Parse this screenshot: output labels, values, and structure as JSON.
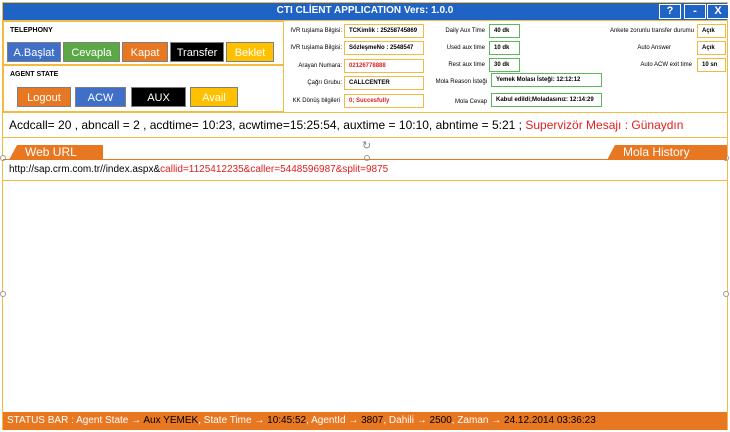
{
  "app": {
    "title": "CTI CLİENT APPLICATION Vers: 1.0.0",
    "help_label": "?",
    "minimize_label": "-",
    "close_label": "X"
  },
  "telephony": {
    "section_label": "TELEPHONY",
    "buttons": [
      {
        "label": "A.Başlat",
        "bg": "#3f6fc6",
        "fg": "#ffffff"
      },
      {
        "label": "Cevapla",
        "bg": "#5aa946",
        "fg": "#ffffff"
      },
      {
        "label": "Kapat",
        "bg": "#e87722",
        "fg": "#ffffff"
      },
      {
        "label": "Transfer",
        "bg": "#000000",
        "fg": "#ffffff"
      },
      {
        "label": "Beklet",
        "bg": "#ffc000",
        "fg": "#ffffff"
      }
    ]
  },
  "agent_state": {
    "section_label": "AGENT STATE",
    "buttons": [
      {
        "label": "Logout",
        "bg": "#e87722",
        "fg": "#ffffff"
      },
      {
        "label": "ACW",
        "bg": "#3f6fc6",
        "fg": "#ffffff"
      },
      {
        "label": "AUX",
        "bg": "#000000",
        "fg": "#ffffff"
      },
      {
        "label": "Avail",
        "bg": "#ffc000",
        "fg": "#ffffff"
      }
    ]
  },
  "call_info": {
    "ivr1_label": "IVR tuşlama Bilgisi:",
    "ivr1_value": "TCKimlik : 25258745869",
    "ivr2_label": "IVR tuşlama Bilgisi:",
    "ivr2_value": "SözleşmeNo : 2548547",
    "caller_label": "Arayan Numara:",
    "caller_value": "02126778888",
    "group_label": "Çağrı Grubu:",
    "group_value": "CALLCENTER",
    "kk_label": "KK Dönüş bilgileri",
    "kk_value": "0; Succesfully"
  },
  "aux_info": {
    "daily_label": "Daily Aux Time",
    "daily_value": "40 dk",
    "used_label": "Used aux time",
    "used_value": "10 dk",
    "rest_label": "Rest aux time",
    "rest_value": "30 dk",
    "reason_label": "Mola Reason İsteği",
    "reason_value": "Yemek Molası İsteği: 12:12:12",
    "reply_label": "Mola Cevap",
    "reply_value": "Kabul edildi;Moladasınız: 12:14:29"
  },
  "settings": {
    "survey_label": "Ankete zorunlu transfer durumu",
    "survey_value": "Açık",
    "answer_label": "Auto Answer",
    "answer_value": "Açık",
    "acw_label": "Auto ACW exit time",
    "acw_value": "10 sn"
  },
  "stats": {
    "text": "Acdcall= 20 , abncall = 2 , acdtime= 10:23, acwtime=15:25:54,  auxtime = 10:10, abntime = 5:21 ;",
    "supervisor_message": "Supervizör Mesajı : Günaydın"
  },
  "tabs": {
    "web_url": "Web URL",
    "mola_history": "Mola History"
  },
  "url": {
    "base": "http://sap.crm.com.tr//index.aspx&",
    "params": "callid=1125412235&caller=5448596987&split=9875"
  },
  "status_bar": {
    "prefix": "STATUS BAR : Agent State",
    "agent_state": "Aux YEMEK",
    "state_time_label": ",  State Time",
    "state_time": "10:45:52",
    "agent_id_label": ", AgentId",
    "agent_id": "3807",
    "dahili_label": ", Dahili",
    "dahili": "2500",
    "zaman_label": ", Zaman",
    "zaman": "24.12.2014 03:36:23",
    "arrow": "→"
  }
}
